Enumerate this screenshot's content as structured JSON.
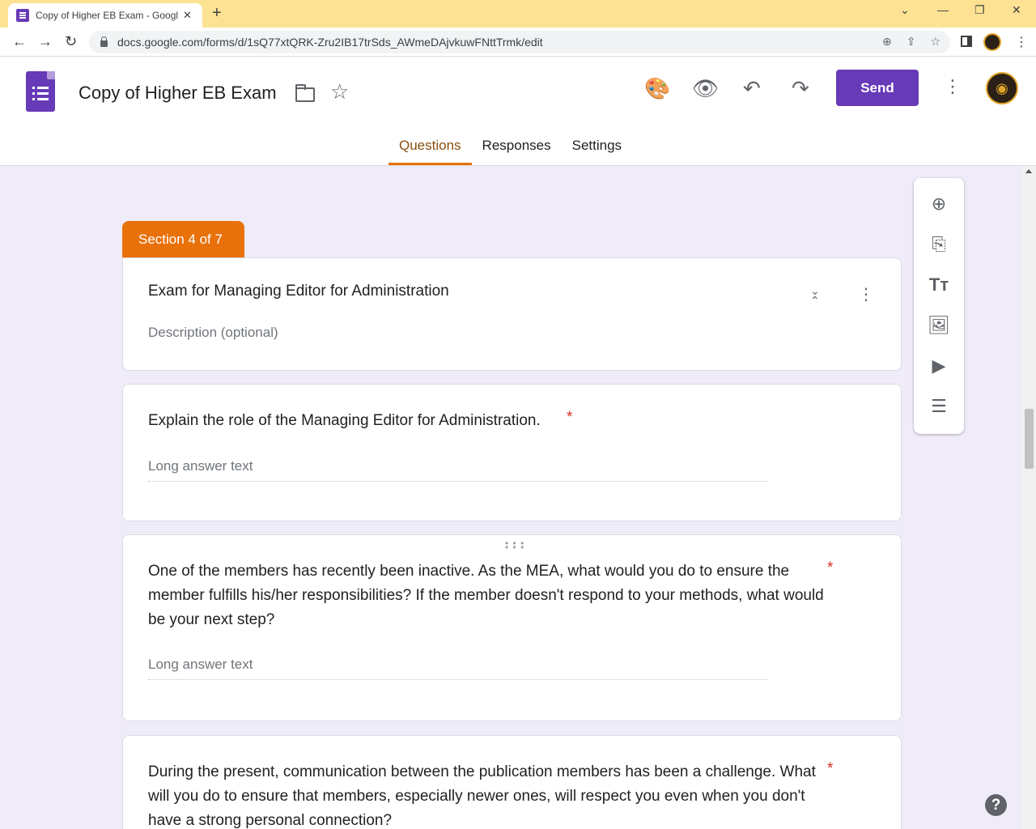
{
  "browser": {
    "tab_title": "Copy of Higher EB Exam - Google Forms",
    "new_tab": "+",
    "tab_close": "✕",
    "url": "docs.google.com/forms/d/1sQ77xtQRK-Zru2IB17trSds_AWmeDAjvkuwFNttTrmk/edit",
    "nav": {
      "back": "←",
      "forward": "→",
      "reload": "↻"
    },
    "window_controls": {
      "chevron": "⌄",
      "minimize": "—",
      "restore": "❐",
      "close": "✕"
    },
    "omni_icons": {
      "zoom": "⊕",
      "share": "⇪",
      "bookmark": "☆"
    },
    "menu": "⋮"
  },
  "header": {
    "title": "Copy of Higher EB Exam",
    "star": "☆",
    "palette_icon": "🎨",
    "preview_icon": "👁",
    "undo_icon": "↶",
    "redo_icon": "↷",
    "send_label": "Send",
    "more": "⋮",
    "avatar_glyph": "◉"
  },
  "tabs": [
    {
      "label": "Questions",
      "active": true
    },
    {
      "label": "Responses",
      "active": false
    },
    {
      "label": "Settings",
      "active": false
    }
  ],
  "toolbar": {
    "add_question": "⊕",
    "import_questions": "⎘",
    "add_title": "Tт",
    "add_image": "🖼",
    "add_video": "▶",
    "add_section": "☰"
  },
  "section": {
    "label": "Section 4 of 7",
    "title": "Exam for Managing Editor for Administration",
    "description_placeholder": "Description (optional)",
    "collapse_icon": "⌄⌃",
    "more": "⋮"
  },
  "questions": [
    {
      "text": "Explain the role of the Managing Editor for Administration.",
      "required_mark": "*",
      "answer_placeholder": "Long answer text"
    },
    {
      "text": "One of the members has recently been inactive. As the MEA, what would you do to ensure the member fulfills his/her responsibilities? If the member doesn't respond to your methods, what would be your next step?",
      "required_mark": "*",
      "answer_placeholder": "Long answer text",
      "drag_handle": "⠿"
    },
    {
      "text": "During the present, communication between the publication members has been a challenge. What will you do to ensure that members, especially newer ones, will respect you even when you don't have a strong personal connection?",
      "required_mark": "*"
    }
  ],
  "help_label": "?"
}
